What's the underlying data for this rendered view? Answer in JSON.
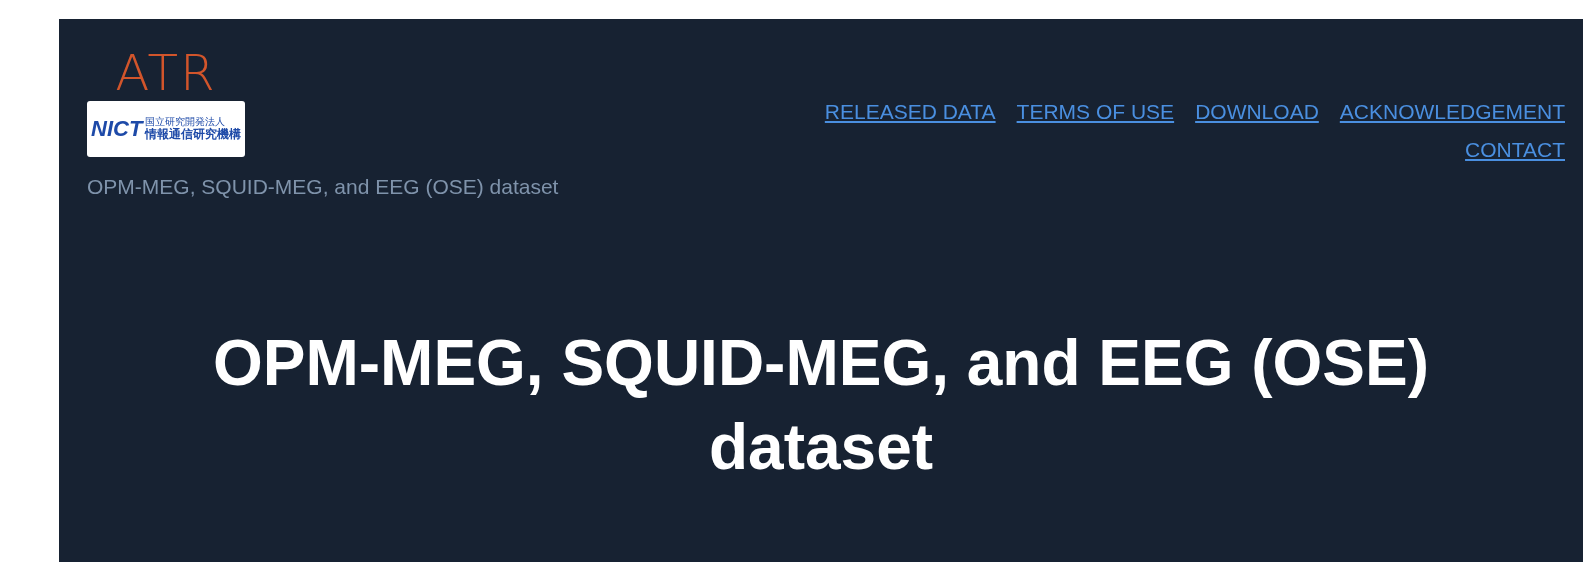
{
  "logos": {
    "atr": "ATR",
    "nict": {
      "mark": "NICT",
      "small": "国立研究開発法人",
      "name": "情報通信研究機構"
    }
  },
  "site_subtitle": "OPM-MEG, SQUID-MEG, and EEG (OSE) dataset",
  "nav": [
    {
      "label": "RELEASED DATA"
    },
    {
      "label": "TERMS OF USE"
    },
    {
      "label": "DOWNLOAD"
    },
    {
      "label": "ACKNOWLEDGEMENT"
    },
    {
      "label": "CONTACT"
    }
  ],
  "heading": "OPM-MEG, SQUID-MEG, and EEG (OSE) dataset"
}
